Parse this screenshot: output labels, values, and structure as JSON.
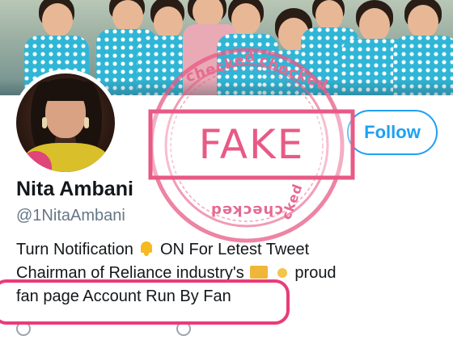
{
  "profile": {
    "display_name": "Nita Ambani",
    "handle": "@1NitaAmbani",
    "follow_label": "Follow",
    "bio": {
      "line1_a": "Turn Notification",
      "line1_b": "ON For Letest Tweet",
      "line2_a": "Chairman of Reliance industry's",
      "line2_b": "proud",
      "line3": "fan page  Account Run By Fan"
    }
  },
  "stamp": {
    "label": "FAKE",
    "ring_text_top_left": "checked",
    "ring_text_top_right": "checked",
    "ring_text_bottom": "checked",
    "ring_text_right": "cked",
    "color": "#e85a86"
  },
  "colors": {
    "follow_accent": "#1da1f2",
    "marker": "#e83c7a",
    "bell": "#f5b921",
    "uniform": "#2fb6d6"
  },
  "icons": [
    "bell-icon",
    "emoji-icon"
  ]
}
